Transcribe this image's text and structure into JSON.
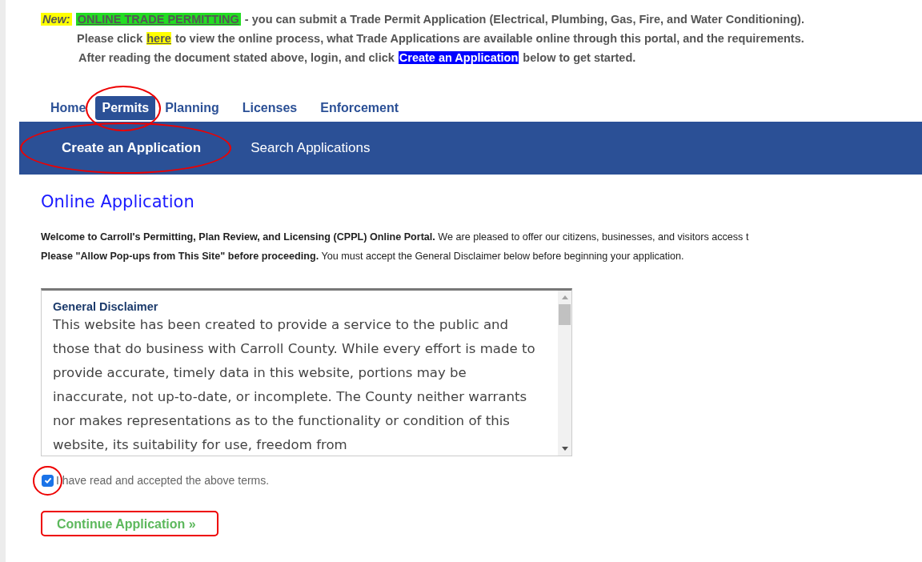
{
  "notice": {
    "label": "New:",
    "link": "ONLINE TRADE PERMITTING",
    "line1": "- you can submit a Trade Permit Application (Electrical, Plumbing, Gas, Fire, and Water Conditioning).",
    "line2_before": "Please click",
    "line2_after": "to view the online process, what Trade Applications are available online through this portal, and the requirements.",
    "line3_before": "After reading the document stated above, login, and click",
    "line3_highlight": "Create an Application",
    "line3_after": "below to get started.",
    "here_link": "here"
  },
  "tabs": [
    {
      "label": "Home",
      "selected": false,
      "highlighted": false
    },
    {
      "label": "Permits",
      "selected": true,
      "highlighted": true
    },
    {
      "label": "Planning",
      "selected": false,
      "highlighted": false
    },
    {
      "label": "Licenses",
      "selected": false,
      "highlighted": false
    },
    {
      "label": "Enforcement",
      "selected": false,
      "highlighted": false
    }
  ],
  "subnav": [
    {
      "label": "Create an Application",
      "selected": true,
      "highlighted": true
    },
    {
      "label": "Search Applications",
      "selected": false,
      "highlighted": false
    }
  ],
  "heading": "Online Application",
  "intro": [
    "**Welcome to Carroll's Permitting, Plan Review, and Licensing (CPPL) Online Portal.**  We are pleased to offer our citizens, businesses, and visitors access t",
    "**Please \"Allow Pop-ups from This Site\" before proceeding.** You must accept the General Disclaimer below before beginning your application."
  ],
  "disclaimer": {
    "title": "General Disclaimer",
    "text": "This website has been created to provide a service to the public and those that do business with Carroll County.  While every effort is made to provide accurate, timely data in this website, portions may be inaccurate, not up-to-date, or incomplete.  The County neither warrants nor makes representations as to the functionality or condition of this website, its suitability for use, freedom from"
  },
  "accept": {
    "label": "I have read and accepted the above terms.",
    "checked": true,
    "highlighted": true
  },
  "continue_button": {
    "label": "Continue Application »",
    "highlighted": true
  }
}
